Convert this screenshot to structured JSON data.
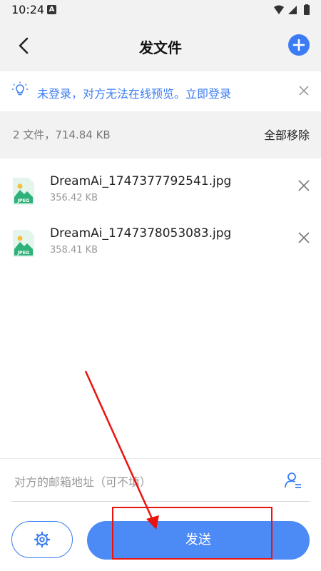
{
  "status_bar": {
    "time": "10:24",
    "notification_badge": "A"
  },
  "header": {
    "title": "发文件"
  },
  "notice": {
    "text": "未登录，对方无法在线预览。立即登录"
  },
  "summary": {
    "count_text": "2 文件，714.84 KB",
    "remove_all_label": "全部移除"
  },
  "files": [
    {
      "name": "DreamAi_1747377792541.jpg",
      "size": "356.42 KB",
      "type_label": "JPEG"
    },
    {
      "name": "DreamAi_1747378053083.jpg",
      "size": "358.41 KB",
      "type_label": "JPEG"
    }
  ],
  "email": {
    "placeholder": "对方的邮箱地址（可不填）"
  },
  "actions": {
    "send_label": "发送"
  },
  "colors": {
    "accent": "#3b7cf5",
    "annotation": "#e8140f"
  },
  "icons": [
    "back-arrow-icon",
    "add-icon",
    "lightbulb-icon",
    "close-icon",
    "jpeg-file-icon",
    "contact-icon",
    "gear-icon",
    "wifi-icon",
    "signal-icon",
    "battery-icon"
  ]
}
